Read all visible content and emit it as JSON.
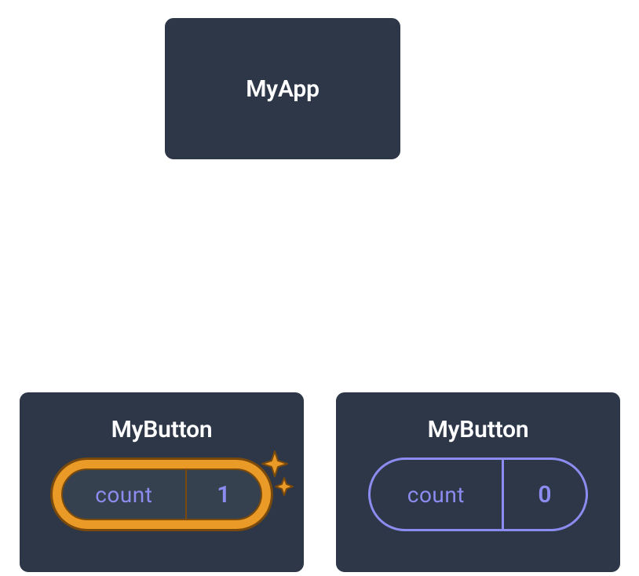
{
  "tree": {
    "root": {
      "label": "MyApp"
    },
    "children": [
      {
        "label": "MyButton",
        "state": {
          "name": "count",
          "value": "1"
        },
        "highlighted": true
      },
      {
        "label": "MyButton",
        "state": {
          "name": "count",
          "value": "0"
        },
        "highlighted": false
      }
    ]
  },
  "colors": {
    "node_bg": "#2d3748",
    "node_border": "#ffffff",
    "pill_outline": "#8c8cf0",
    "pill_gold": "#e99a27",
    "pill_gold_dark": "#7a4a0c"
  }
}
